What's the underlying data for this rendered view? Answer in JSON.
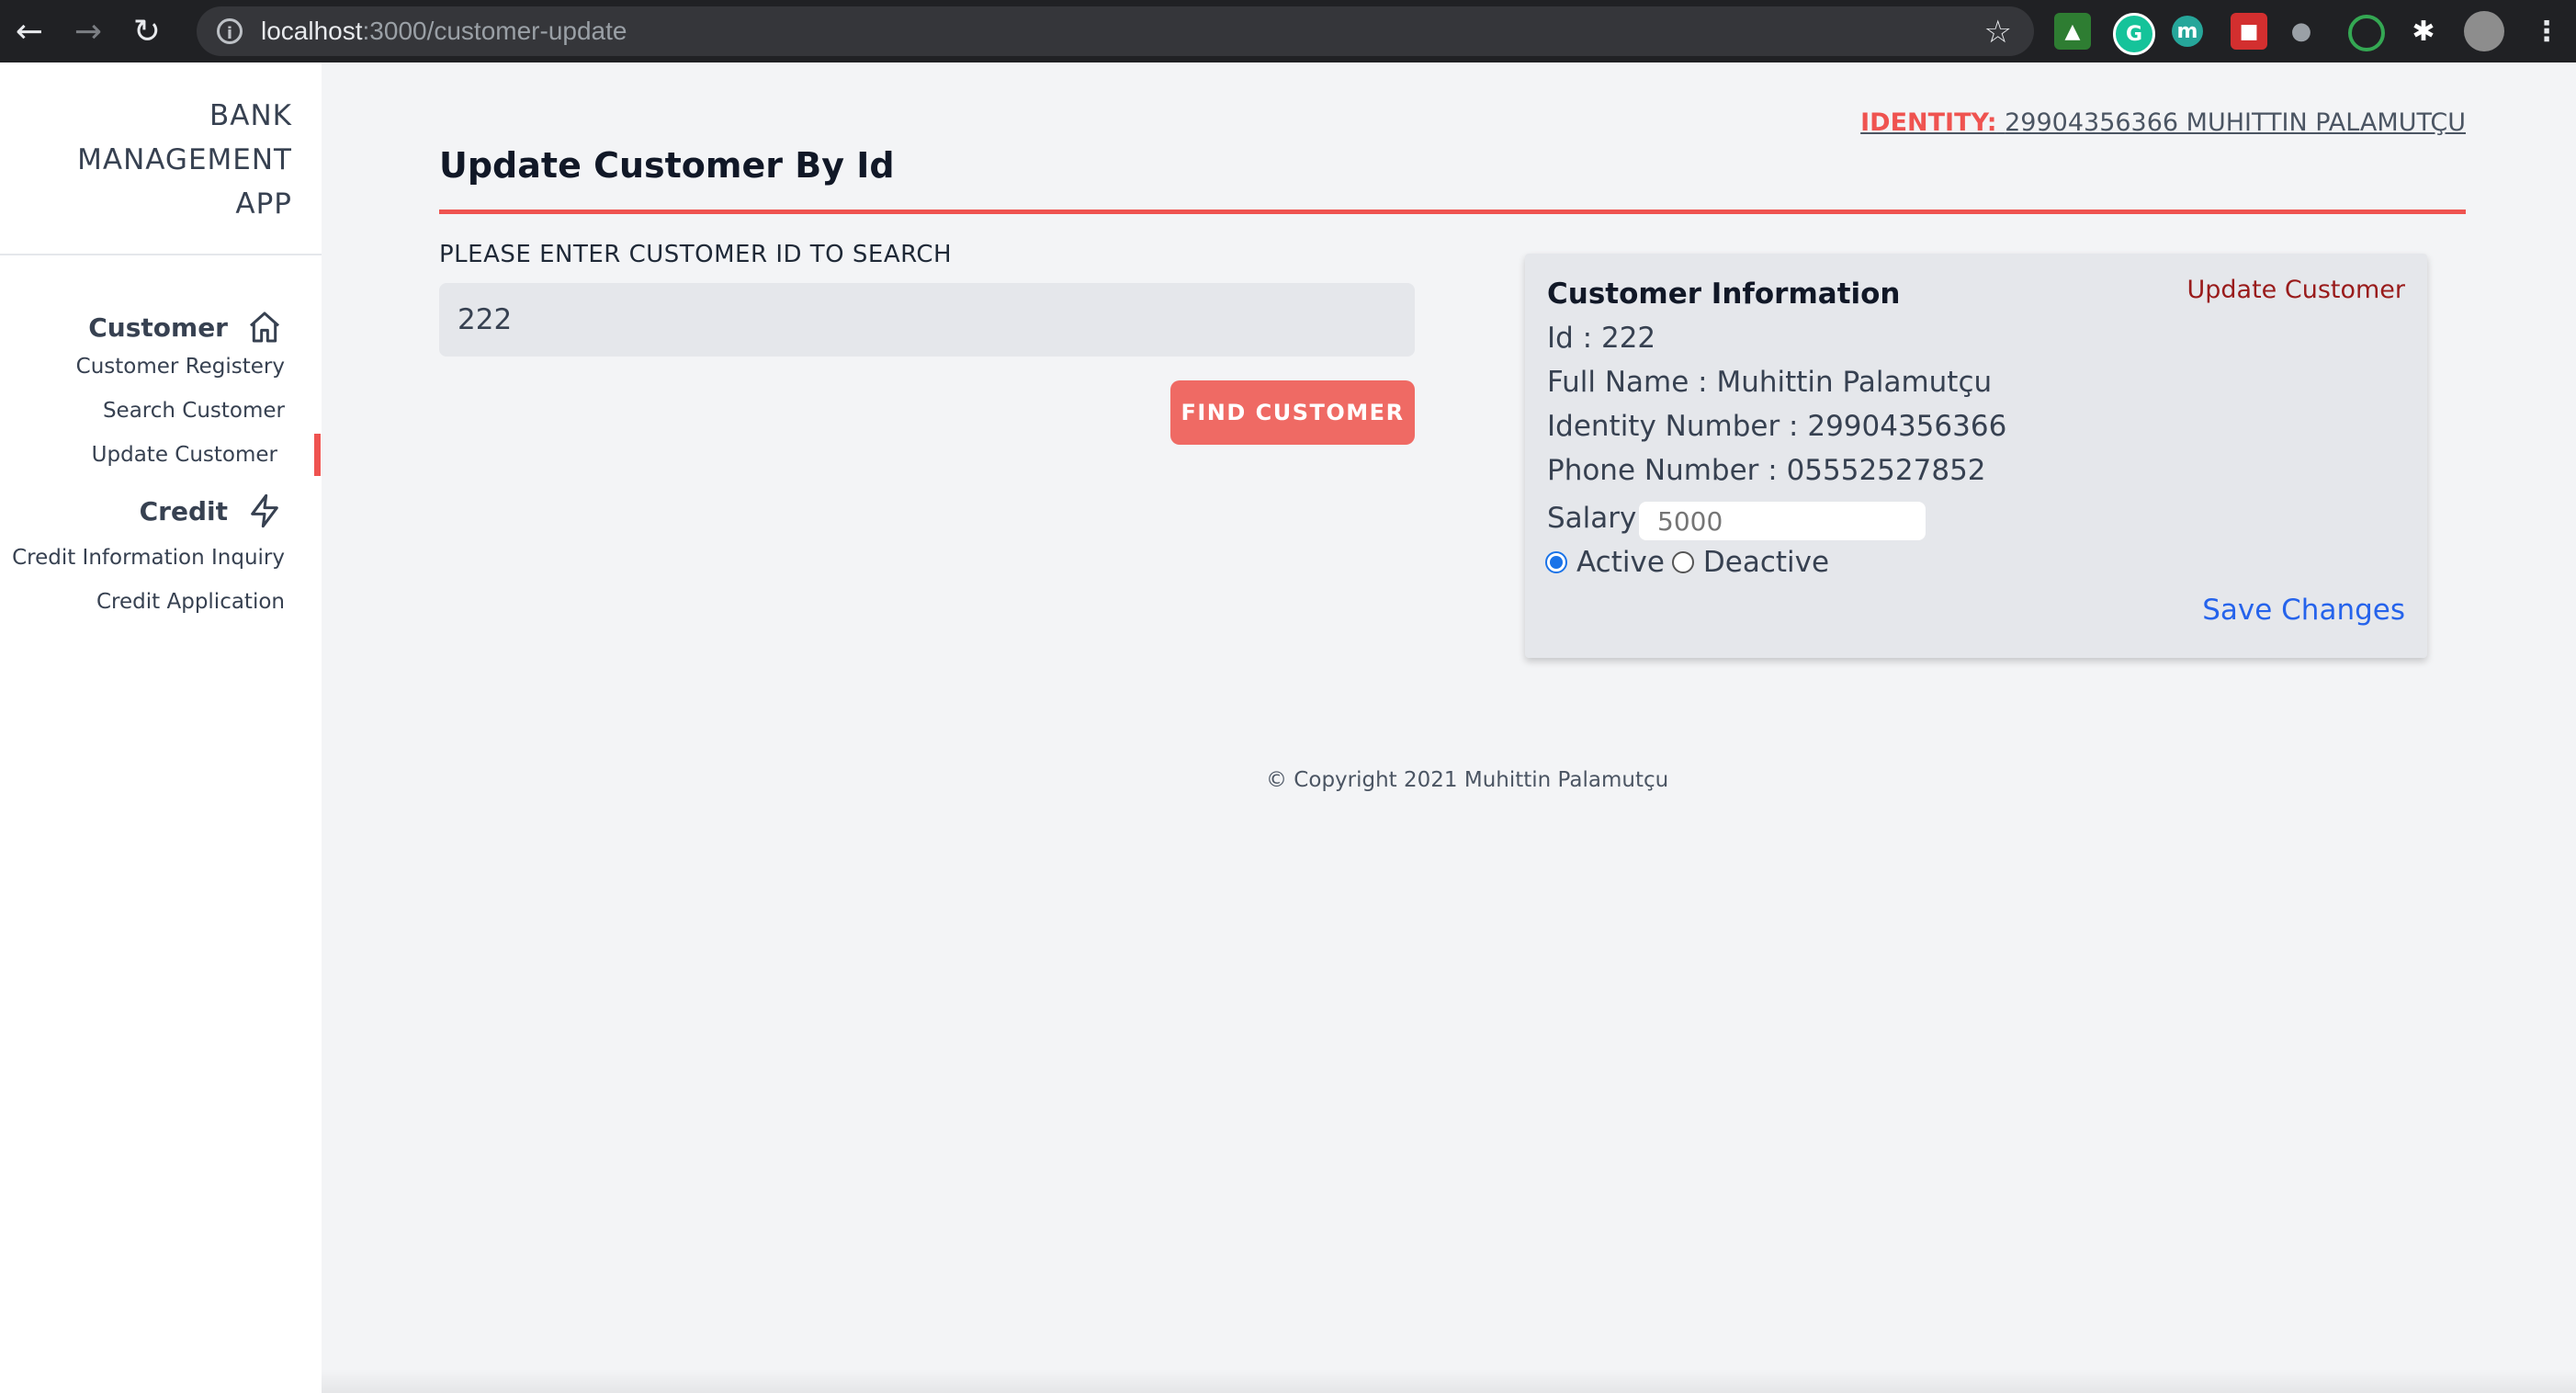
{
  "browser": {
    "url_host": "localhost",
    "url_path": ":3000/customer-update",
    "icons": [
      "back-arrow-icon",
      "forward-arrow-icon",
      "reload-icon",
      "info-icon",
      "star-icon",
      "extensions-icon"
    ]
  },
  "sidebar": {
    "brand": [
      "BANK",
      "MANAGEMENT",
      "APP"
    ],
    "customer_section": "Customer",
    "customer_items": [
      "Customer Registery",
      "Search Customer",
      "Update Customer"
    ],
    "credit_section": "Credit",
    "credit_items": [
      "Credit Information Inquiry",
      "Credit Application"
    ],
    "active_item": "Update Customer"
  },
  "header": {
    "identity_label": "IDENTITY:",
    "identity_value": "29904356366 MUHITTIN PALAMUTÇU"
  },
  "main": {
    "title": "Update Customer By Id",
    "search_label": "PLEASE ENTER CUSTOMER ID TO SEARCH",
    "search_value": "222",
    "find_button": "FIND CUSTOMER"
  },
  "card": {
    "title": "Customer Information",
    "update_link": "Update Customer",
    "id_line": "Id : 222",
    "full_name_line": "Full Name : Muhittin Palamutçu",
    "identity_line": "Identity Number : 29904356366",
    "phone_line": "Phone Number : 05552527852",
    "salary_label": "Salary",
    "salary_placeholder": "5000",
    "status_active": "Active",
    "status_deactive": "Deactive",
    "selected_status": "Active",
    "save_link": "Save Changes"
  },
  "footer": {
    "copyright": "© Copyright 2021 Muhittin Palamutçu"
  },
  "colors": {
    "accent": "#ef5350",
    "button": "#ef6a64",
    "link_blue": "#2563eb",
    "link_dark_red": "#991b1b",
    "sidebar_bg": "#ffffff",
    "page_bg": "#f3f4f6",
    "card_bg": "#e5e7eb"
  }
}
